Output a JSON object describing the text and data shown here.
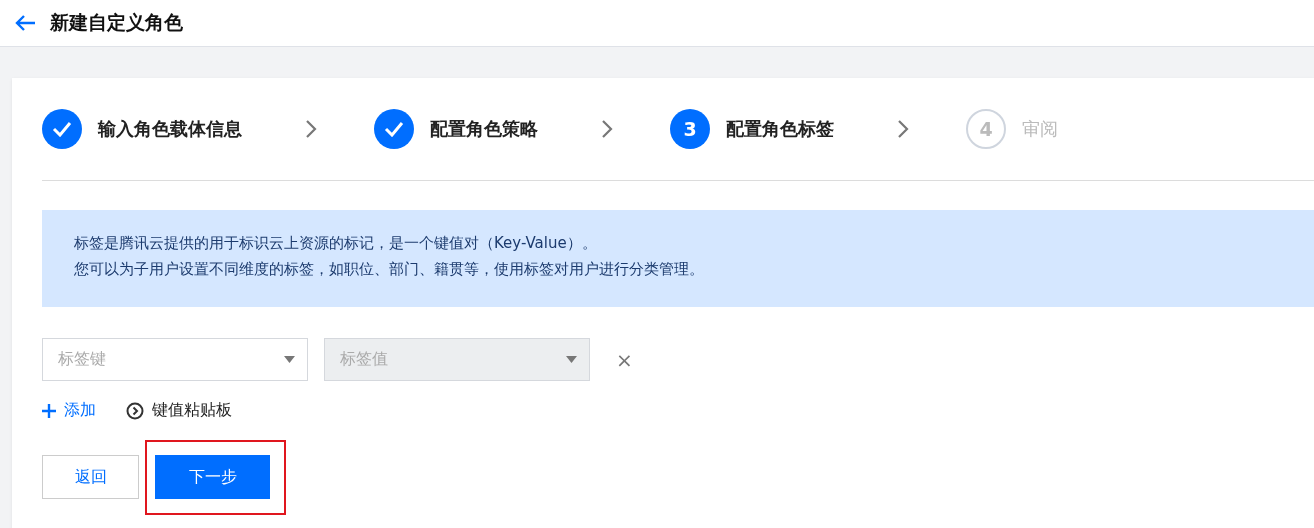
{
  "header": {
    "title": "新建自定义角色"
  },
  "steps": [
    {
      "label": "输入角色载体信息",
      "done": true,
      "current": false
    },
    {
      "label": "配置角色策略",
      "done": true,
      "current": false
    },
    {
      "number": "3",
      "label": "配置角色标签",
      "done": false,
      "current": true
    },
    {
      "number": "4",
      "label": "审阅",
      "done": false,
      "current": false
    }
  ],
  "notice": {
    "lines": [
      "标签是腾讯云提供的用于标识云上资源的标记，是一个键值对（Key-Value）。",
      "您可以为子用户设置不同维度的标签，如职位、部门、籍贯等，使用标签对用户进行分类管理。"
    ]
  },
  "tag_row": {
    "key": {
      "placeholder": "标签键",
      "disabled": false
    },
    "value": {
      "placeholder": "标签值",
      "disabled": true
    },
    "remove": "×"
  },
  "actions": {
    "add": "添加",
    "clipboard": "键值粘贴板"
  },
  "buttons": [
    {
      "label": "返回",
      "kind": "secondary",
      "highlighted": false
    },
    {
      "label": "下一步",
      "kind": "primary",
      "highlighted": true
    }
  ]
}
